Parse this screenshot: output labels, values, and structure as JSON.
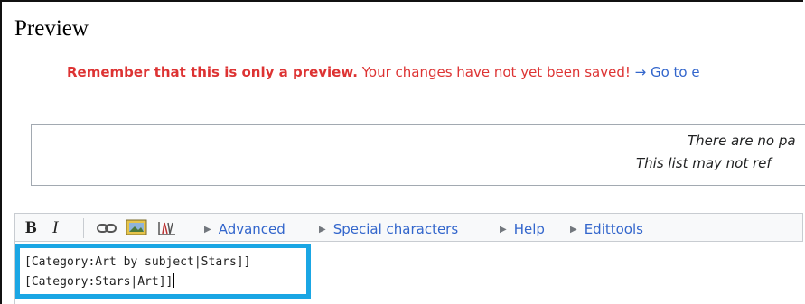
{
  "heading": {
    "title": "Preview"
  },
  "notice": {
    "strong": "Remember that this is only a preview.",
    "rest": " Your changes have not yet been saved! ",
    "link": "→ Go to e"
  },
  "templates_box": {
    "line1": "There are no pa",
    "line2": "This list may not ref"
  },
  "toolbar": {
    "bold": "B",
    "italic": "I",
    "menus": [
      "Advanced",
      "Special characters",
      "Help",
      "Edittools"
    ]
  },
  "editor": {
    "lines": [
      "[Category:Art by subject|Stars]]",
      "[Category:Stars|Art]]"
    ]
  },
  "colors": {
    "highlight": "#1aa6e4",
    "notice_red": "#dd3333",
    "link_blue": "#3366cc"
  }
}
